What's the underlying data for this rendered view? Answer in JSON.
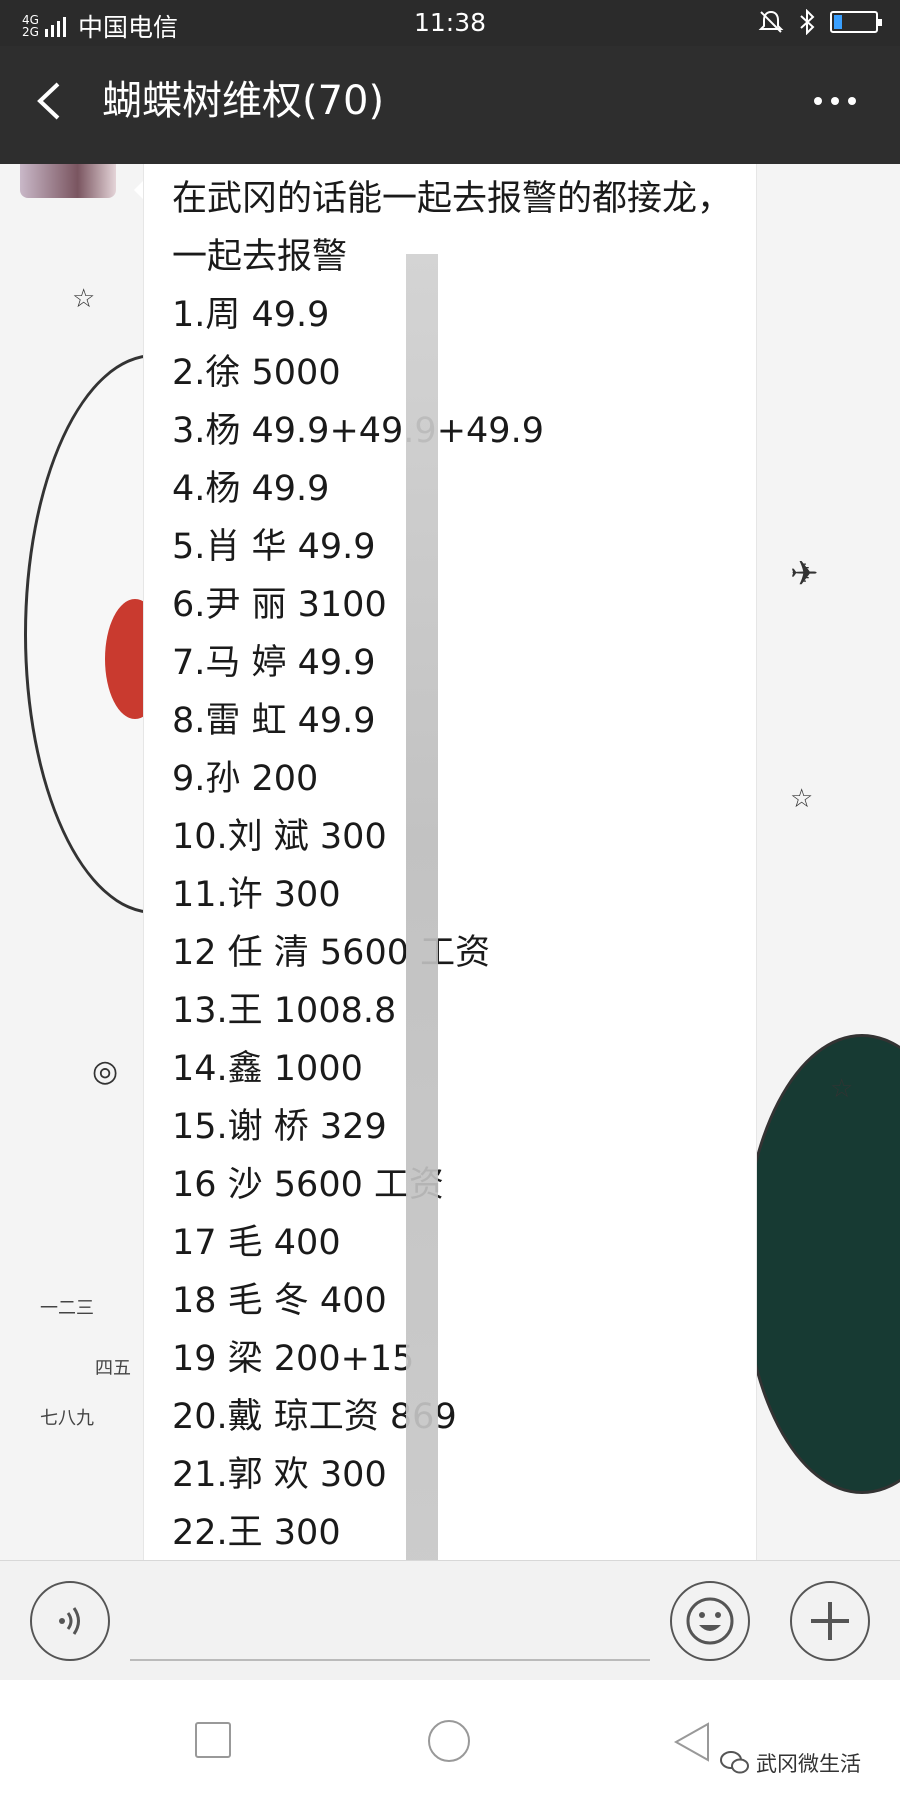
{
  "status_bar": {
    "network_top": "4G",
    "network_bottom": "2G",
    "carrier": "中国电信",
    "time": "11:38"
  },
  "header": {
    "title": "蝴蝶树维权(70)"
  },
  "message": {
    "heading": "在武冈的话能一起去报警的都接龙，一起去报警",
    "lines": [
      "1.周    49.9",
      "2.徐    5000",
      "3.杨    49.9+49.9+49.9",
      "4.杨    49.9",
      "5.肖    华 49.9",
      "6.尹    丽 3100",
      "7.马    婷 49.9",
      "8.雷    虹 49.9",
      "9.孙    200",
      "10.刘    斌 300",
      "11.许    300",
      "12 任    清 5600 工资",
      "13.王    1008.8",
      "14.鑫    1000",
      "15.谢    桥 329",
      "16 沙    5600 工资",
      "17 毛    400",
      "18 毛    冬 400",
      "19 梁    200+15",
      "20.戴    琼工资 869",
      "21.郭    欢 300",
      "22.王    300"
    ]
  },
  "watermark": {
    "text": "武冈微生活"
  },
  "icons": {
    "back": "back-arrow-icon",
    "more": "more-dots-icon",
    "voice": "voice-icon",
    "emoji": "emoji-icon",
    "plus": "plus-icon",
    "wechat": "wechat-icon"
  },
  "colors": {
    "title_bar": "#2e2e2e",
    "bubble": "#ffffff",
    "chat_bg": "#f4f4f4",
    "battery_fill": "#3aa0ff"
  }
}
